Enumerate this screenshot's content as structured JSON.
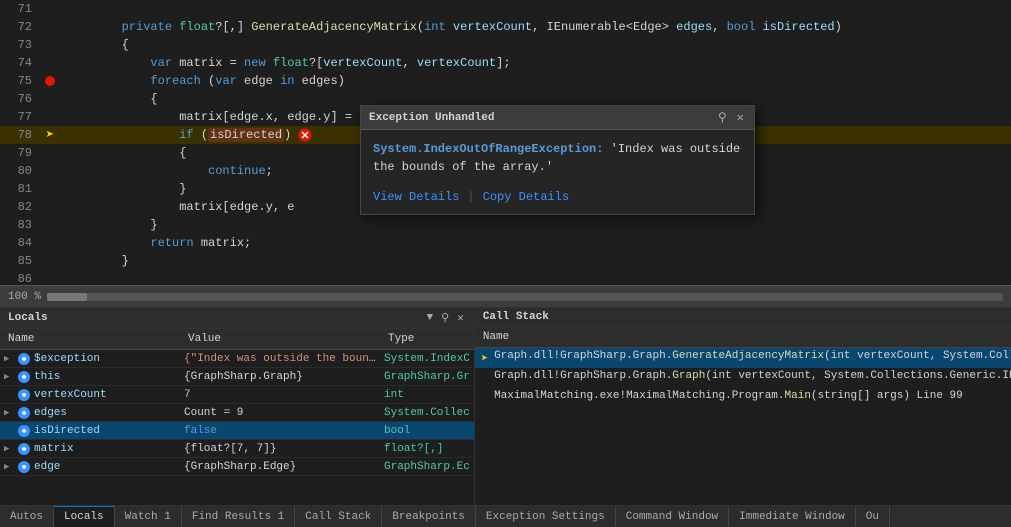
{
  "editor": {
    "lines": [
      {
        "num": "71",
        "indent": 0,
        "content": "",
        "type": "blank"
      },
      {
        "num": "72",
        "indent": 0,
        "content": "        private float?[,] GenerateAdjacencyMatrix(int vertexCount, IEnumerable<Edge> edges, bool isDirected)",
        "type": "code",
        "has_breakpoint": false,
        "arrow": false
      },
      {
        "num": "73",
        "indent": 0,
        "content": "        {",
        "type": "code"
      },
      {
        "num": "74",
        "indent": 0,
        "content": "            var matrix = new float?[vertexCount, vertexCount];",
        "type": "code"
      },
      {
        "num": "75",
        "indent": 0,
        "content": "            foreach (var edge in edges)",
        "type": "code",
        "has_breakpoint": true
      },
      {
        "num": "76",
        "indent": 0,
        "content": "            {",
        "type": "code"
      },
      {
        "num": "77",
        "indent": 0,
        "content": "                matrix[edge.x, edge.y] = edge.weight;",
        "type": "code"
      },
      {
        "num": "78",
        "indent": 0,
        "content": "                if (isDirected)",
        "type": "code",
        "arrow": true,
        "has_breakpoint": true,
        "error_token": "isDirected",
        "highlighted": true
      },
      {
        "num": "79",
        "indent": 0,
        "content": "                {",
        "type": "code"
      },
      {
        "num": "80",
        "indent": 0,
        "content": "                    continue;",
        "type": "code"
      },
      {
        "num": "81",
        "indent": 0,
        "content": "                }",
        "type": "code"
      },
      {
        "num": "82",
        "indent": 0,
        "content": "                matrix[edge.y, e",
        "type": "code"
      },
      {
        "num": "83",
        "indent": 0,
        "content": "            }",
        "type": "code"
      },
      {
        "num": "84",
        "indent": 0,
        "content": "            return matrix;",
        "type": "code"
      },
      {
        "num": "85",
        "indent": 0,
        "content": "        }",
        "type": "code"
      },
      {
        "num": "86",
        "indent": 0,
        "content": "",
        "type": "blank"
      }
    ]
  },
  "exception_popup": {
    "title": "Exception Unhandled",
    "pin_label": "⚲",
    "close_label": "✕",
    "message_type": "System.IndexOutOfRangeException:",
    "message_text": " 'Index was outside the bounds of the array.'",
    "view_details_label": "View Details",
    "copy_details_label": "Copy Details",
    "separator": "|"
  },
  "locals_panel": {
    "title": "Locals",
    "columns": {
      "name": "Name",
      "value": "Value",
      "type": "Type"
    },
    "rows": [
      {
        "name": "$exception",
        "value": "{\"Index was outside the bounds of the array.\"",
        "type": "System.IndexC",
        "expanded": false,
        "selected": false
      },
      {
        "name": "this",
        "value": "{GraphSharp.Graph}",
        "type": "GraphSharp.Gr",
        "expanded": false,
        "selected": false
      },
      {
        "name": "vertexCount",
        "value": "7",
        "type": "int",
        "expanded": false,
        "selected": false
      },
      {
        "name": "edges",
        "value": "Count = 9",
        "type": "System.Collec",
        "expanded": false,
        "selected": false
      },
      {
        "name": "isDirected",
        "value": "false",
        "type": "bool",
        "expanded": false,
        "selected": true,
        "highlight": true
      },
      {
        "name": "matrix",
        "value": "{float?[7, 7]}",
        "type": "float?[,]",
        "expanded": false,
        "selected": false
      },
      {
        "name": "edge",
        "value": "{GraphSharp.Edge}",
        "type": "GraphSharp.Ec",
        "expanded": false,
        "selected": false
      }
    ]
  },
  "callstack_panel": {
    "title": "Call Stack",
    "column": "Name",
    "frames": [
      {
        "text": "Graph.dll!GraphSharp.Graph.GenerateAdjacencyMatrix(int vertexCount, System.Collections.",
        "active": true
      },
      {
        "text": "Graph.dll!GraphSharp.Graph.Graph(int vertexCount, System.Collections.Generic.IEnumera",
        "active": false
      },
      {
        "text": "MaximalMatching.exe!MaximalMatching.Program.Main(string[] args) Line 99",
        "active": false
      }
    ]
  },
  "zoom": {
    "label": "100 %"
  },
  "bottom_tabs": [
    {
      "label": "Autos",
      "active": false
    },
    {
      "label": "Locals",
      "active": true
    },
    {
      "label": "Watch 1",
      "active": false
    },
    {
      "label": "Find Results 1",
      "active": false
    },
    {
      "label": "Call Stack",
      "active": false
    },
    {
      "label": "Breakpoints",
      "active": false
    },
    {
      "label": "Exception Settings",
      "active": false
    },
    {
      "label": "Command Window",
      "active": false
    },
    {
      "label": "Immediate Window",
      "active": false
    },
    {
      "label": "Ou",
      "active": false
    }
  ]
}
